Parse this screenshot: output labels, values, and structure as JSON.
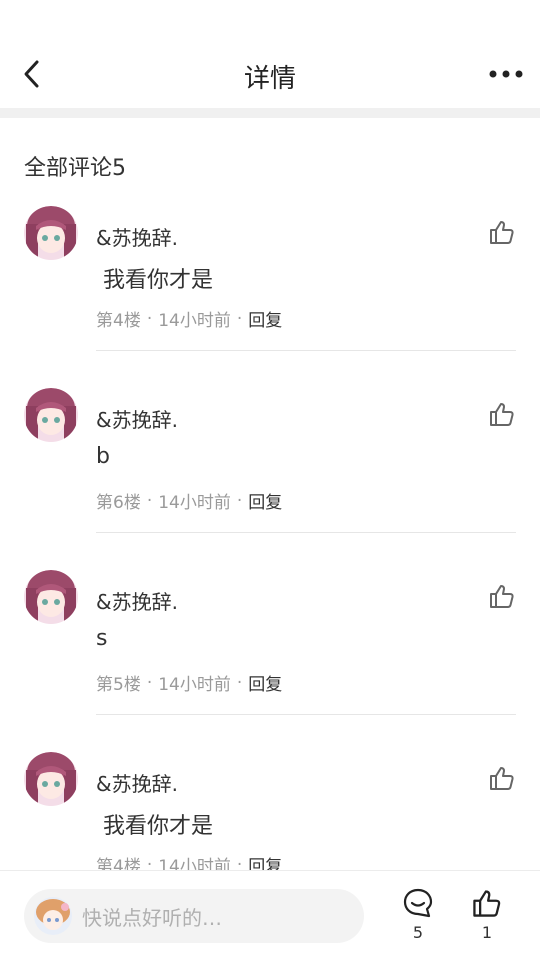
{
  "header": {
    "title": "详情",
    "back_icon": "chevron-left-icon",
    "more_icon": "more-dots-icon"
  },
  "section_title": "全部评论5",
  "comments": [
    {
      "user": "&苏挽辞.",
      "content": " 我看你才是",
      "floor": "第4楼",
      "time": "14小时前",
      "reply": "回复"
    },
    {
      "user": "&苏挽辞.",
      "content": "b",
      "floor": "第6楼",
      "time": "14小时前",
      "reply": "回复"
    },
    {
      "user": "&苏挽辞.",
      "content": "s",
      "floor": "第5楼",
      "time": "14小时前",
      "reply": "回复"
    },
    {
      "user": "&苏挽辞.",
      "content": " 我看你才是",
      "floor": "第4楼",
      "time": "14小时前",
      "reply": "回复"
    }
  ],
  "meta_separator": "·",
  "bottom": {
    "placeholder": "快说点好听的…",
    "comment_count": "5",
    "like_count": "1"
  },
  "colors": {
    "accent_text": "#333333",
    "muted_text": "#9a9a9a",
    "divider": "#f0f0f0"
  }
}
